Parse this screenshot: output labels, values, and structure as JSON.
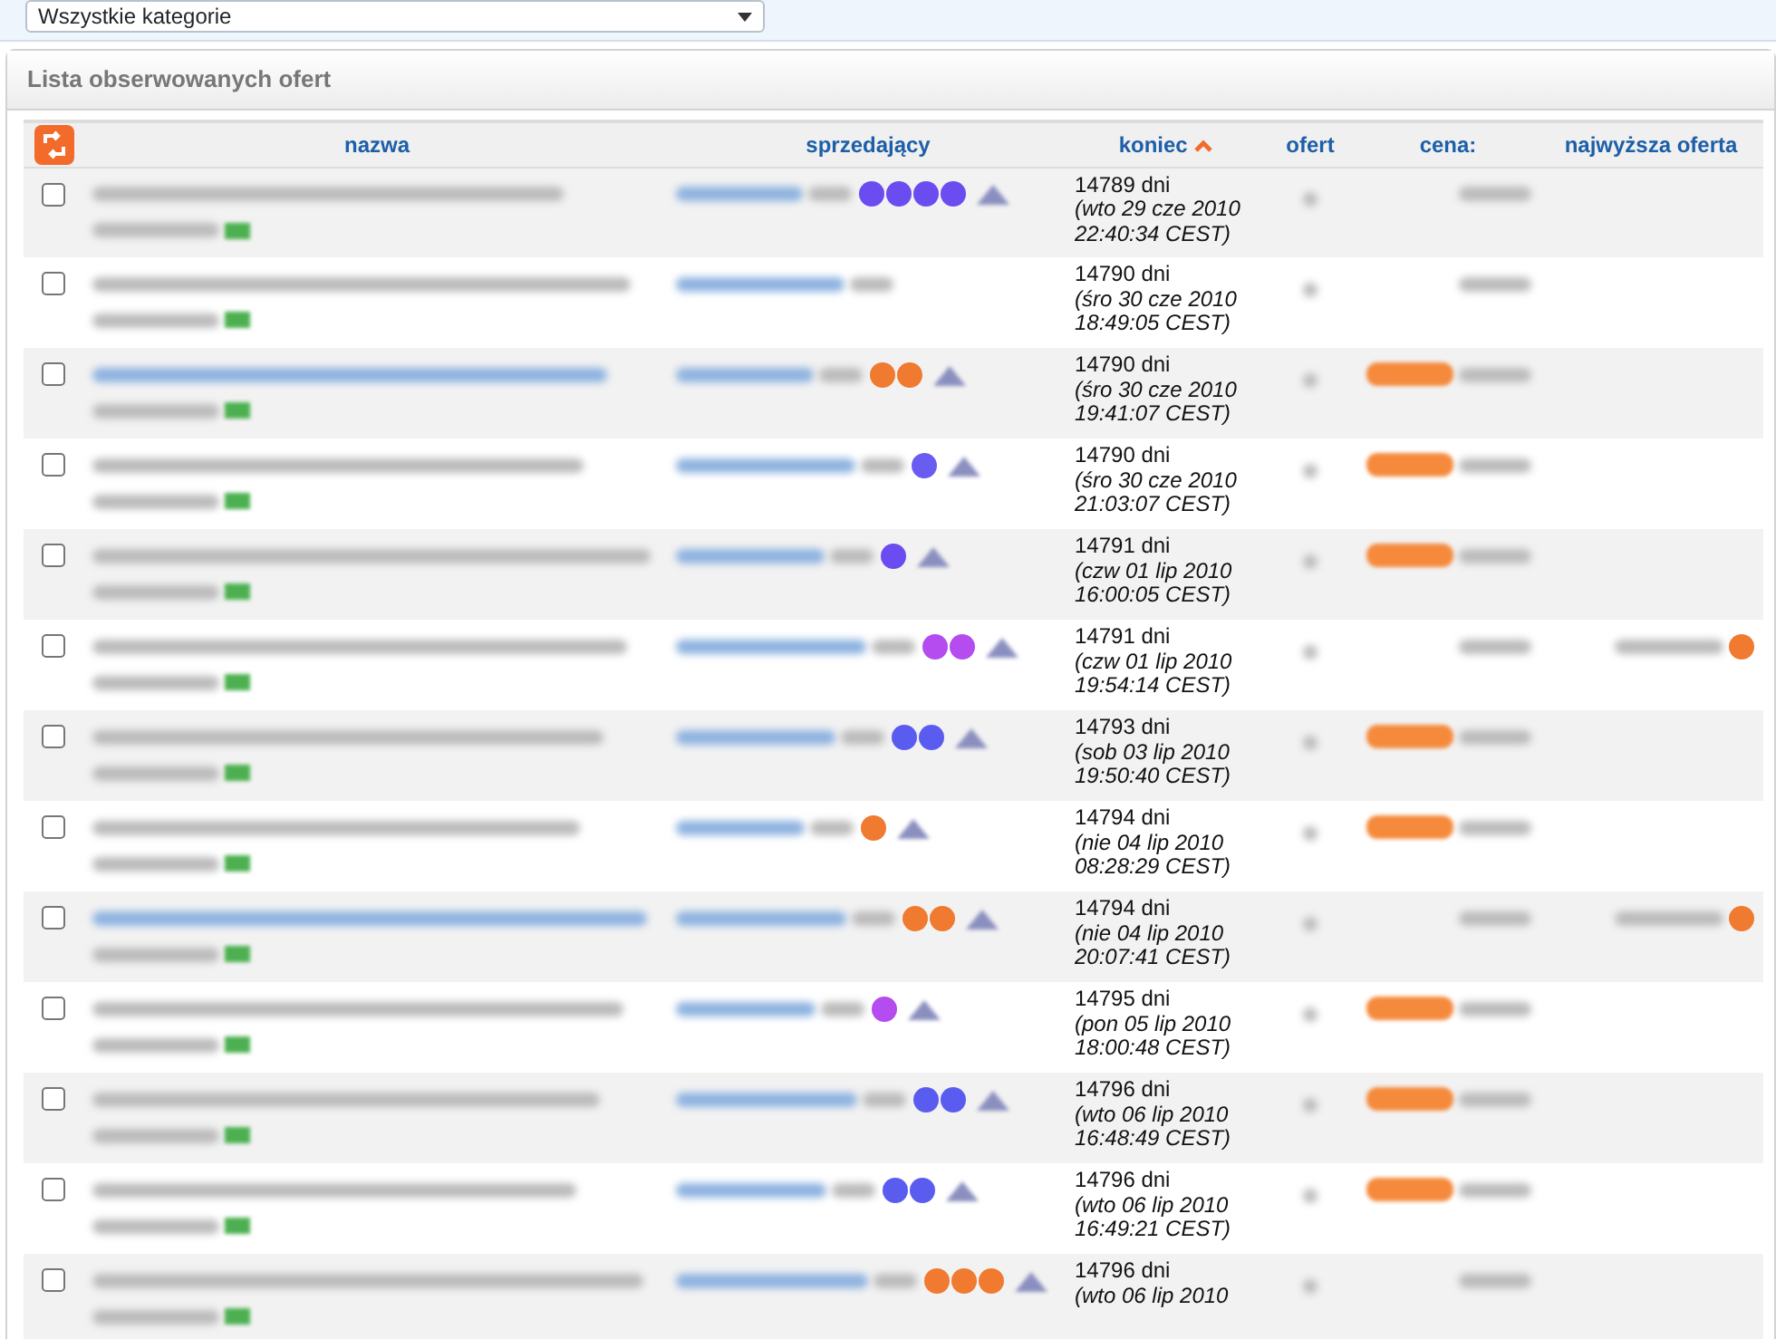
{
  "category_select": {
    "value": "Wszystkie kategorie"
  },
  "panel": {
    "title": "Lista obserwowanych ofert"
  },
  "columns": [
    {
      "label": "nazwa",
      "sorted": false
    },
    {
      "label": "sprzedający",
      "sorted": false
    },
    {
      "label": "koniec",
      "sorted": true
    },
    {
      "label": "ofert",
      "sorted": false
    },
    {
      "label": "cena:",
      "sorted": false
    },
    {
      "label": "najwyższa oferta",
      "sorted": false
    }
  ],
  "rows": [
    {
      "checked": false,
      "days": "14789 dni",
      "date": "(wto 29 cze 2010",
      "time": "22:40:34 CEST)",
      "badges": [
        {
          "color": "#6a4cf0"
        },
        {
          "color": "#6a4cf0"
        },
        {
          "color": "#6a4cf0"
        },
        {
          "color": "#6a4cf0"
        }
      ],
      "buy_now": false,
      "bidder": false
    },
    {
      "checked": false,
      "days": "14790 dni",
      "date": "(śro 30 cze 2010",
      "time": "18:49:05 CEST)",
      "buy_now": false,
      "bidder": false
    },
    {
      "checked": false,
      "days": "14790 dni",
      "date": "(śro 30 cze 2010",
      "time": "19:41:07 CEST)",
      "badges": [
        {
          "color": "#f07a30"
        },
        {
          "color": "#f07a30"
        }
      ],
      "buy_now": true,
      "bidder": false
    },
    {
      "checked": false,
      "days": "14790 dni",
      "date": "(śro 30 cze 2010",
      "time": "21:03:07 CEST)",
      "badges": [
        {
          "color": "#6a5cf0"
        }
      ],
      "buy_now": true,
      "bidder": false
    },
    {
      "checked": false,
      "days": "14791 dni",
      "date": "(czw 01 lip 2010",
      "time": "16:00:05 CEST)",
      "badges": [
        {
          "color": "#6a4cf0"
        }
      ],
      "buy_now": true,
      "bidder": false
    },
    {
      "checked": false,
      "days": "14791 dni",
      "date": "(czw 01 lip 2010",
      "time": "19:54:14 CEST)",
      "badges": [
        {
          "color": "#b44cf0"
        },
        {
          "color": "#b44cf0"
        }
      ],
      "buy_now": false,
      "bidder": true
    },
    {
      "checked": false,
      "days": "14793 dni",
      "date": "(sob 03 lip 2010",
      "time": "19:50:40 CEST)",
      "badges": [
        {
          "color": "#5a5cf0"
        },
        {
          "color": "#5a5cf0"
        }
      ],
      "buy_now": true,
      "bidder": false
    },
    {
      "checked": false,
      "days": "14794 dni",
      "date": "(nie 04 lip 2010",
      "time": "08:28:29 CEST)",
      "badges": [
        {
          "color": "#f07a30"
        }
      ],
      "buy_now": true,
      "bidder": false
    },
    {
      "checked": false,
      "days": "14794 dni",
      "date": "(nie 04 lip 2010",
      "time": "20:07:41 CEST)",
      "badges": [
        {
          "color": "#f07a30"
        },
        {
          "color": "#f07a30"
        }
      ],
      "buy_now": false,
      "bidder": true
    },
    {
      "checked": false,
      "days": "14795 dni",
      "date": "(pon 05 lip 2010",
      "time": "18:00:48 CEST)",
      "badges": [
        {
          "color": "#b44cf0"
        }
      ],
      "buy_now": true,
      "bidder": false
    },
    {
      "checked": false,
      "days": "14796 dni",
      "date": "(wto 06 lip 2010",
      "time": "16:48:49 CEST)",
      "badges": [
        {
          "color": "#5a5cf0"
        },
        {
          "color": "#5a5cf0"
        }
      ],
      "buy_now": true,
      "bidder": false
    },
    {
      "checked": false,
      "days": "14796 dni",
      "date": "(wto 06 lip 2010",
      "time": "16:49:21 CEST)",
      "badges": [
        {
          "color": "#5a5cf0"
        },
        {
          "color": "#5a5cf0"
        }
      ],
      "buy_now": true,
      "bidder": false
    },
    {
      "checked": false,
      "days": "14796 dni",
      "date": "(wto 06 lip 2010",
      "badges": [
        {
          "color": "#f07a30"
        },
        {
          "color": "#f07a30"
        },
        {
          "color": "#f07a30"
        }
      ],
      "buy_now": false,
      "bidder": false
    }
  ]
}
